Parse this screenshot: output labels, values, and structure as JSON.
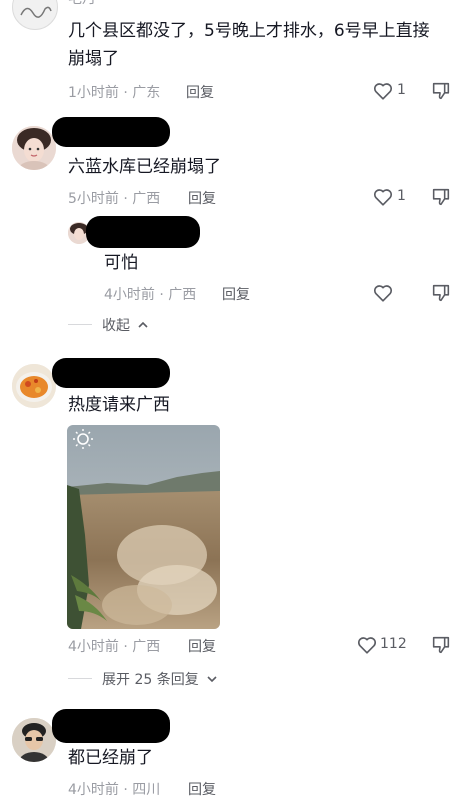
{
  "comments": [
    {
      "partial_top_text": "毛月",
      "text_line1": "几个县区都没了，5号晚上才排水，6号早上直接",
      "text_line2": "崩塌了",
      "meta": "1小时前 · 广东",
      "reply_label": "回复",
      "likes": "1"
    },
    {
      "text": "六蓝水库已经崩塌了",
      "meta": "5小时前 · 广西",
      "reply_label": "回复",
      "likes": "1",
      "sub_reply": {
        "text": "可怕",
        "meta": "4小时前 · 广西",
        "reply_label": "回复"
      },
      "collapse_label": "收起"
    },
    {
      "text": "热度请来广西",
      "meta": "4小时前 · 广西",
      "reply_label": "回复",
      "likes": "112",
      "expand_label": "展开 25 条回复"
    },
    {
      "text": "都已经崩了",
      "meta": "4小时前 · 四川",
      "reply_label": "回复"
    }
  ],
  "colors": {
    "text": "#161823",
    "meta": "#9a9ca3",
    "action": "#5a5c63"
  }
}
